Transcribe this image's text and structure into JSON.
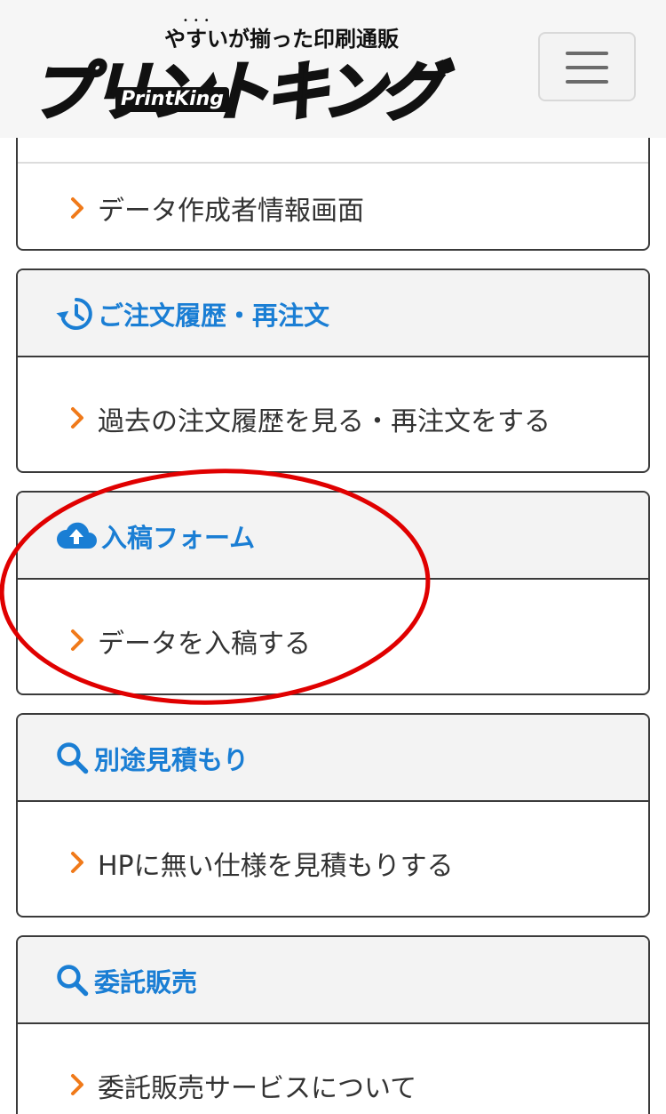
{
  "header": {
    "tagline": "やすいが揃った印刷通販",
    "logo_main": "プリントキング",
    "logo_sub": "PrintKing",
    "menu_icon": "hamburger-menu-icon"
  },
  "sections": [
    {
      "title": "",
      "links": [
        "データ作成者情報画面"
      ]
    },
    {
      "title": "ご注文履歴・再注文",
      "icon": "history-icon",
      "links": [
        "過去の注文履歴を見る・再注文をする"
      ]
    },
    {
      "title": "入稿フォーム",
      "icon": "cloud-upload-icon",
      "links": [
        "データを入稿する"
      ]
    },
    {
      "title": "別途見積もり",
      "icon": "search-icon",
      "links": [
        "HPに無い仕様を見積もりする"
      ]
    },
    {
      "title": "委託販売",
      "icon": "search-icon",
      "links": [
        "委託販売サービスについて"
      ]
    }
  ],
  "colors": {
    "accent_blue": "#1a7ed4",
    "chevron_orange": "#f07a1a",
    "annotation_red": "#e00000",
    "border": "#3a3a3a",
    "header_bg": "#f6f6f6"
  }
}
